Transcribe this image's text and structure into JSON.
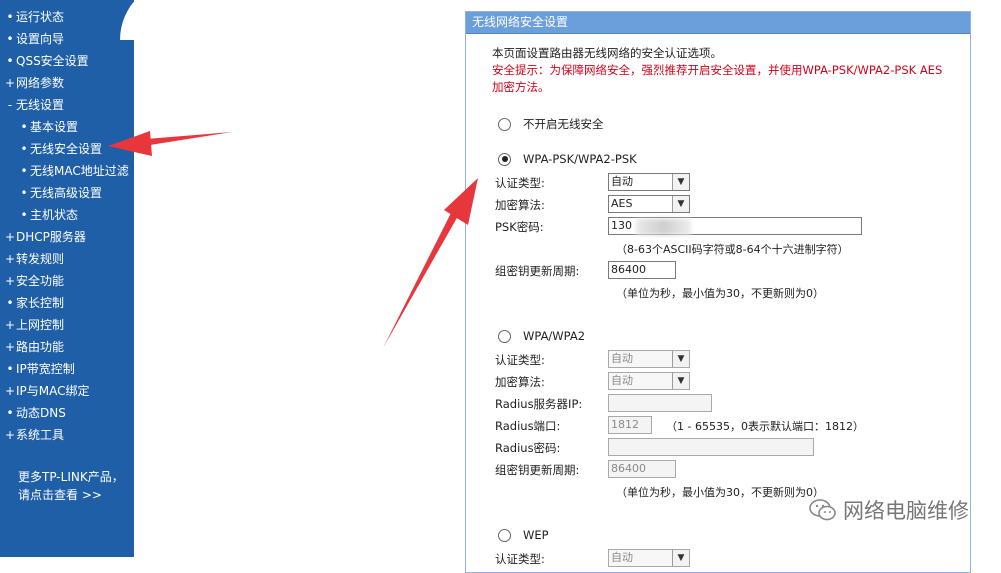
{
  "sidebar": {
    "items": [
      {
        "mark": "•",
        "label": "运行状态"
      },
      {
        "mark": "•",
        "label": "设置向导"
      },
      {
        "mark": "•",
        "label": "QSS安全设置"
      },
      {
        "mark": "+",
        "label": "网络参数"
      },
      {
        "mark": "-",
        "label": "无线设置"
      },
      {
        "mark": "•",
        "label": "基本设置"
      },
      {
        "mark": "•",
        "label": "无线安全设置"
      },
      {
        "mark": "•",
        "label": "无线MAC地址过滤"
      },
      {
        "mark": "•",
        "label": "无线高级设置"
      },
      {
        "mark": "•",
        "label": "主机状态"
      },
      {
        "mark": "+",
        "label": "DHCP服务器"
      },
      {
        "mark": "+",
        "label": "转发规则"
      },
      {
        "mark": "+",
        "label": "安全功能"
      },
      {
        "mark": "•",
        "label": "家长控制"
      },
      {
        "mark": "+",
        "label": "上网控制"
      },
      {
        "mark": "+",
        "label": "路由功能"
      },
      {
        "mark": "•",
        "label": "IP带宽控制"
      },
      {
        "mark": "+",
        "label": "IP与MAC绑定"
      },
      {
        "mark": "•",
        "label": "动态DNS"
      },
      {
        "mark": "+",
        "label": "系统工具"
      }
    ],
    "more_line1": "更多TP-LINK产品，",
    "more_line2": "请点击查看 >>"
  },
  "panel": {
    "title": "无线网络安全设置",
    "desc": "本页面设置路由器无线网络的安全认证选项。",
    "warn_line1": "安全提示：为保障网络安全，强烈推荐开启安全设置，并使用WPA-PSK/WPA2-PSK AES",
    "warn_line2": "加密方法。",
    "opt_none": "不开启无线安全",
    "opt_psk": "WPA-PSK/WPA2-PSK",
    "psk": {
      "auth_label": "认证类型:",
      "auth_value": "自动",
      "enc_label": "加密算法:",
      "enc_value": "AES",
      "pwd_label": "PSK密码:",
      "pwd_value": "130",
      "pwd_hint": "（8-63个ASCII码字符或8-64个十六进制字符）",
      "renew_label": "组密钥更新周期:",
      "renew_value": "86400",
      "renew_hint": "（单位为秒，最小值为30，不更新则为0）"
    },
    "opt_wpa": "WPA/WPA2",
    "wpa": {
      "auth_label": "认证类型:",
      "auth_value": "自动",
      "enc_label": "加密算法:",
      "enc_value": "自动",
      "radius_ip_label": "Radius服务器IP:",
      "radius_ip_value": "",
      "radius_port_label": "Radius端口:",
      "radius_port_value": "1812",
      "radius_port_hint": "（1 - 65535，0表示默认端口：1812）",
      "radius_pwd_label": "Radius密码:",
      "radius_pwd_value": "",
      "renew_label": "组密钥更新周期:",
      "renew_value": "86400",
      "renew_hint": "（单位为秒，最小值为30，不更新则为0）"
    },
    "opt_wep": "WEP",
    "wep": {
      "auth_label": "认证类型:",
      "auth_value": "自动"
    }
  },
  "watermark": "网络电脑维修",
  "colors": {
    "sidebar": "#1f5fa7",
    "title_bar": "#6b9fdc",
    "warning": "#d0021b",
    "arrow": "#e8363d"
  }
}
